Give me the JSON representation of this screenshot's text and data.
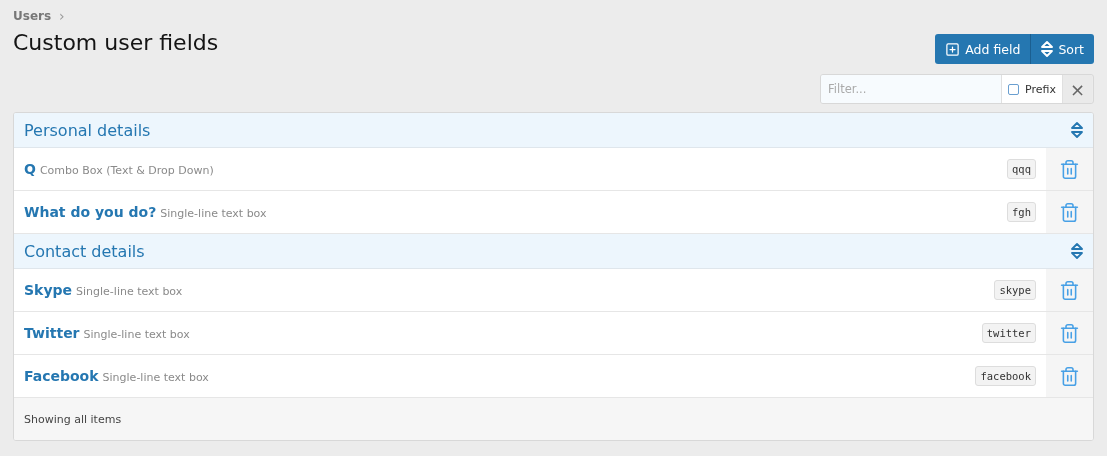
{
  "breadcrumb": {
    "label": "Users",
    "separator": "›"
  },
  "title": "Custom user fields",
  "buttons": [
    {
      "kind": "add",
      "label": "Add field"
    },
    {
      "kind": "sort",
      "label": "Sort"
    }
  ],
  "filter": {
    "placeholder": "Filter...",
    "prefix": {
      "label": "Prefix",
      "checked": false
    },
    "clear": "×"
  },
  "groups": [
    {
      "title": "Personal details",
      "items": [
        {
          "name": "Q",
          "type": "Combo Box (Text & Drop Down)",
          "id": "qqq"
        },
        {
          "name": "What do you do?",
          "type": "Single-line text box",
          "id": "fgh"
        }
      ]
    },
    {
      "title": "Contact details",
      "items": [
        {
          "name": "Skype",
          "type": "Single-line text box",
          "id": "skype"
        },
        {
          "name": "Twitter",
          "type": "Single-line text box",
          "id": "twitter"
        },
        {
          "name": "Facebook",
          "type": "Single-line text box",
          "id": "facebook"
        }
      ]
    }
  ],
  "footer": "Showing all items"
}
